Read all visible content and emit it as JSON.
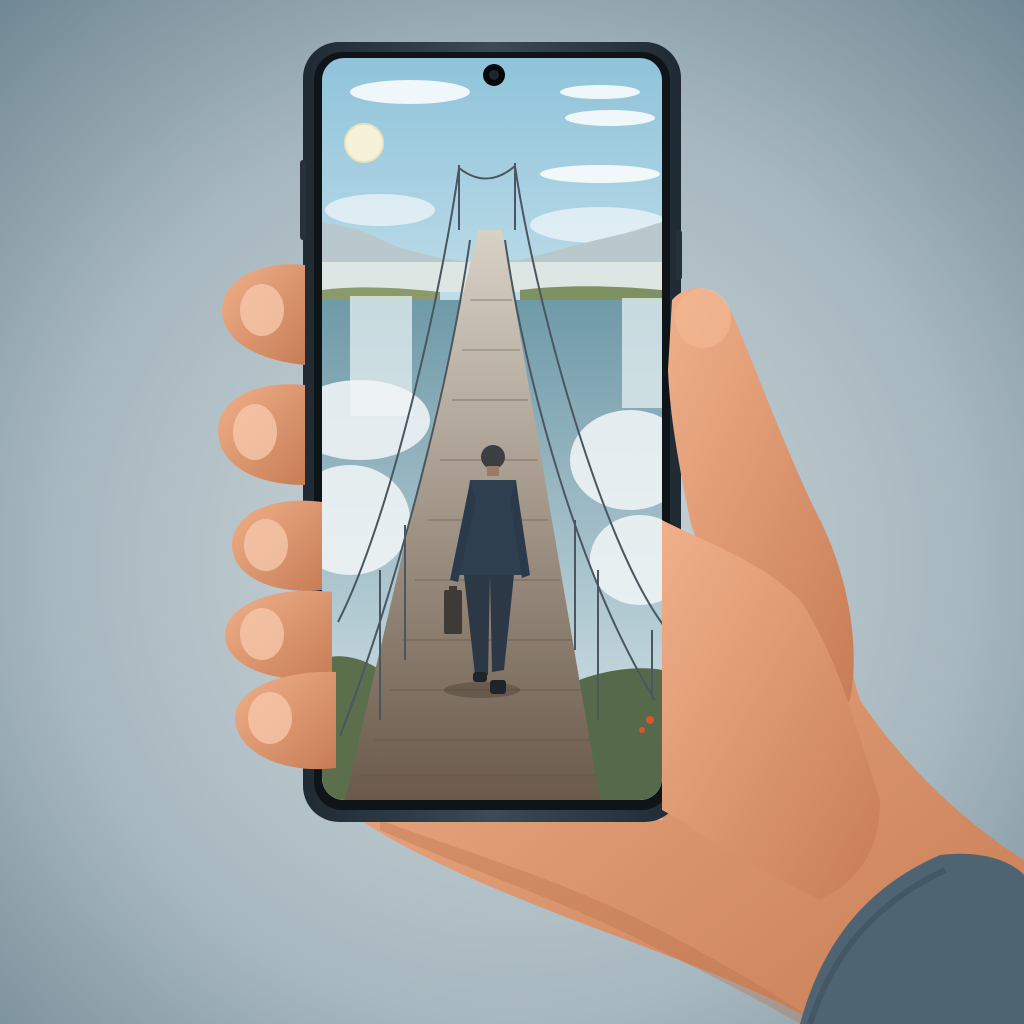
{
  "scene": {
    "subject": "hand-holding-smartphone",
    "screen_content": "man-with-briefcase-walking-on-suspension-bridge",
    "background_color": "#9fb0b8",
    "phone_frame_color": "#2f3a44",
    "sky_color": "#bcdbe8",
    "bridge_color": "#a8a29a",
    "skin_color": "#e8a27a",
    "sleeve_color": "#4f6472"
  }
}
